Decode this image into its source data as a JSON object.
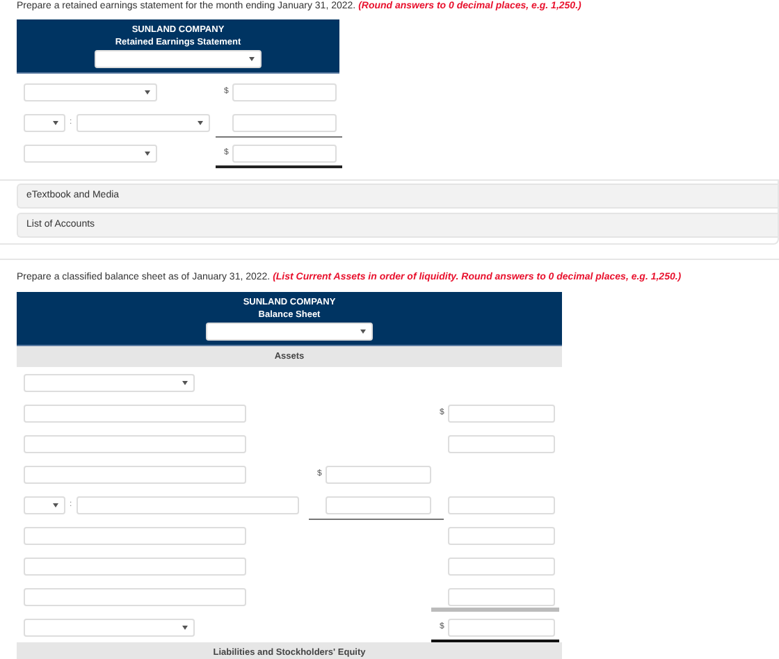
{
  "retained": {
    "instruction": "Prepare a retained earnings statement for the month ending January 31, 2022.",
    "note": "(Round answers to 0 decimal places, e.g. 1,250.)",
    "header": {
      "company": "SUNLAND COMPANY",
      "title": "Retained Earnings Statement"
    },
    "rows": [
      {
        "kind": "select",
        "right": {
          "currency": "$"
        }
      },
      {
        "kind": "split",
        "separator": ":",
        "right": {
          "underline": true
        }
      },
      {
        "kind": "select",
        "right": {
          "currency": "$",
          "double_underline": true
        }
      }
    ]
  },
  "links": [
    {
      "label": "eTextbook and Media"
    },
    {
      "label": "List of Accounts"
    }
  ],
  "balance": {
    "instruction": "Prepare a classified balance sheet as of January 31, 2022.",
    "note": "(List Current Assets in order of liquidity. Round answers to 0 decimal places, e.g. 1,250.)",
    "header": {
      "company": "SUNLAND COMPANY",
      "title": "Balance Sheet"
    },
    "sections": [
      {
        "title": "Assets",
        "rows": [
          {
            "kind": "select"
          },
          {
            "kind": "input",
            "right": {
              "currency": "$"
            }
          },
          {
            "kind": "input",
            "right": {}
          },
          {
            "kind": "input",
            "mid": {
              "currency": "$"
            }
          },
          {
            "kind": "split",
            "separator": ":",
            "mid": {
              "underline": true
            },
            "right": {}
          },
          {
            "kind": "input",
            "right": {}
          },
          {
            "kind": "input",
            "right": {}
          },
          {
            "kind": "input",
            "right": {
              "underline": true
            }
          },
          {
            "kind": "select",
            "right": {
              "currency": "$",
              "double_underline": true
            }
          }
        ]
      },
      {
        "title": "Liabilities and Stockholders' Equity"
      }
    ]
  }
}
